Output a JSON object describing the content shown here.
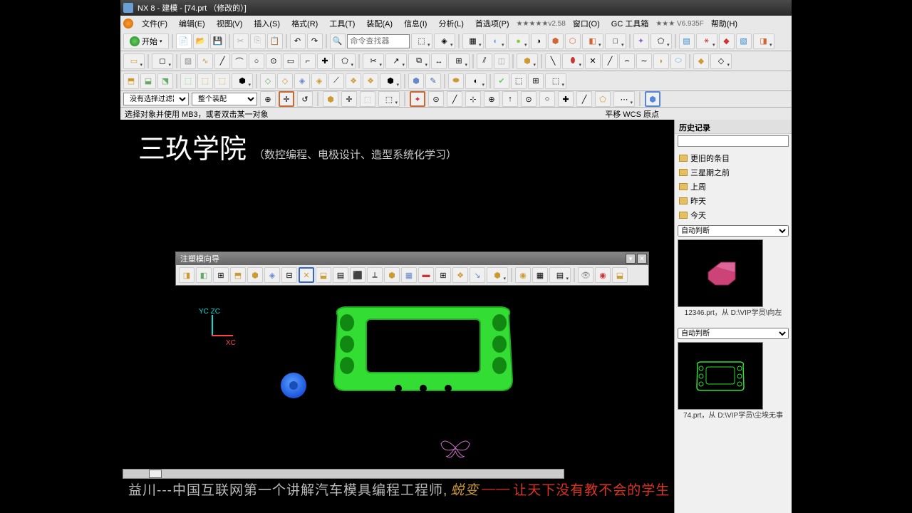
{
  "titlebar": {
    "text": "NX 8 - 建模 - [74.prt （修改的）]"
  },
  "menubar": {
    "items": [
      "文件(F)",
      "编辑(E)",
      "视图(V)",
      "插入(S)",
      "格式(R)",
      "工具(T)",
      "装配(A)",
      "信息(I)",
      "分析(L)",
      "首选项(P)"
    ],
    "version1": "★★★★★v2.58",
    "window": "窗口(O)",
    "gc": "GC 工具箱",
    "version2": "★★★ V6.935F",
    "help": "帮助(H)"
  },
  "start_button": "开始",
  "filter": {
    "dropdown1": "没有选择过滤器",
    "dropdown2": "整个装配"
  },
  "status": {
    "left": "选择对象并使用 MB3，或者双击某一对象",
    "right": "平移 WCS 原点"
  },
  "watermark": {
    "title": "三玖学院",
    "subtitle": "（数控编程、电极设计、造型系统化学习）"
  },
  "axis": {
    "yz": "YC ZC",
    "xc": "XC"
  },
  "mold_panel": {
    "title": "注塑模向导"
  },
  "side": {
    "title": "历史记录",
    "folders": [
      "更旧的条目",
      "三星期之前",
      "上周",
      "昨天",
      "今天"
    ],
    "combo": "自动判断",
    "thumb1_cap": "12346.prt，从 D:\\VIP学员\\向左",
    "thumb2_cap": "74.prt，从 D:\\VIP学员\\尘埃无事"
  },
  "bottom": {
    "name": "益川---中国互联网第一个讲解汽车模具编程工程师,",
    "yellow": "蜕变",
    "dash": "——",
    "red": "让天下没有教不会的学生"
  },
  "cmd_finder": "命令查找器"
}
